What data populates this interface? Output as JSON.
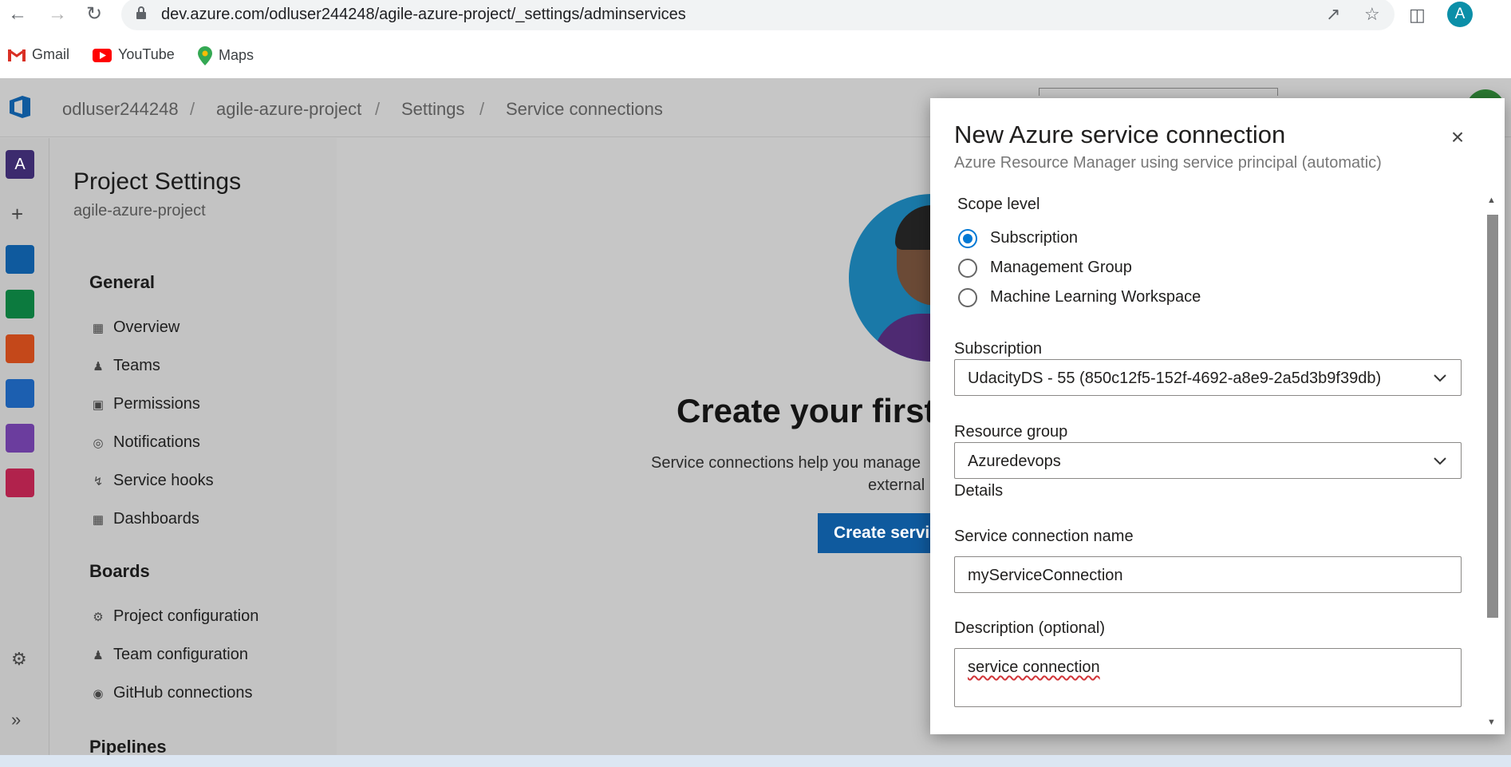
{
  "browser": {
    "url": "dev.azure.com/odluser244248/agile-azure-project/_settings/adminservices",
    "profile_initial": "A",
    "bookmarks": [
      {
        "label": "Gmail",
        "icon": "gmail-icon"
      },
      {
        "label": "YouTube",
        "icon": "youtube-icon"
      },
      {
        "label": "Maps",
        "icon": "maps-icon"
      }
    ]
  },
  "header": {
    "breadcrumbs": [
      "odluser244248",
      "agile-azure-project",
      "Settings",
      "Service connections"
    ],
    "separator": "/"
  },
  "leftrail": {
    "org_initial": "A",
    "items": [
      "org-avatar",
      "new-icon",
      "overview-icon",
      "boards-icon",
      "repos-icon",
      "pipelines-icon",
      "test-plans-icon",
      "artifacts-icon",
      "settings-icon",
      "expand-icon"
    ]
  },
  "settings": {
    "title": "Project Settings",
    "subtitle": "agile-azure-project",
    "sections": [
      {
        "heading": "General",
        "items": [
          "Overview",
          "Teams",
          "Permissions",
          "Notifications",
          "Service hooks",
          "Dashboards"
        ]
      },
      {
        "heading": "Boards",
        "items": [
          "Project configuration",
          "Team configuration",
          "GitHub connections"
        ]
      },
      {
        "heading": "Pipelines",
        "items": []
      }
    ]
  },
  "main": {
    "title": "Create your first s",
    "desc_line1": "Service connections help you manage",
    "desc_line2": "external",
    "button": "Create servic"
  },
  "dialog": {
    "title": "New Azure service connection",
    "subtitle": "Azure Resource Manager using service principal (automatic)",
    "close": "×",
    "scope_label": "Scope level",
    "scope_options": [
      {
        "label": "Subscription",
        "checked": true
      },
      {
        "label": "Management Group",
        "checked": false
      },
      {
        "label": "Machine Learning Workspace",
        "checked": false
      }
    ],
    "subscription_label": "Subscription",
    "subscription_value": "UdacityDS - 55 (850c12f5-152f-4692-a8e9-2a5d3b9f39db)",
    "resource_group_label": "Resource group",
    "resource_group_value": "Azuredevops",
    "details_label": "Details",
    "name_label": "Service connection name",
    "name_value": "myServiceConnection",
    "description_label": "Description (optional)",
    "description_value": "service connection"
  },
  "colors": {
    "accent": "#0078d4",
    "primary_button": "#0f5a9e",
    "overlay": "#c6c6c6"
  }
}
